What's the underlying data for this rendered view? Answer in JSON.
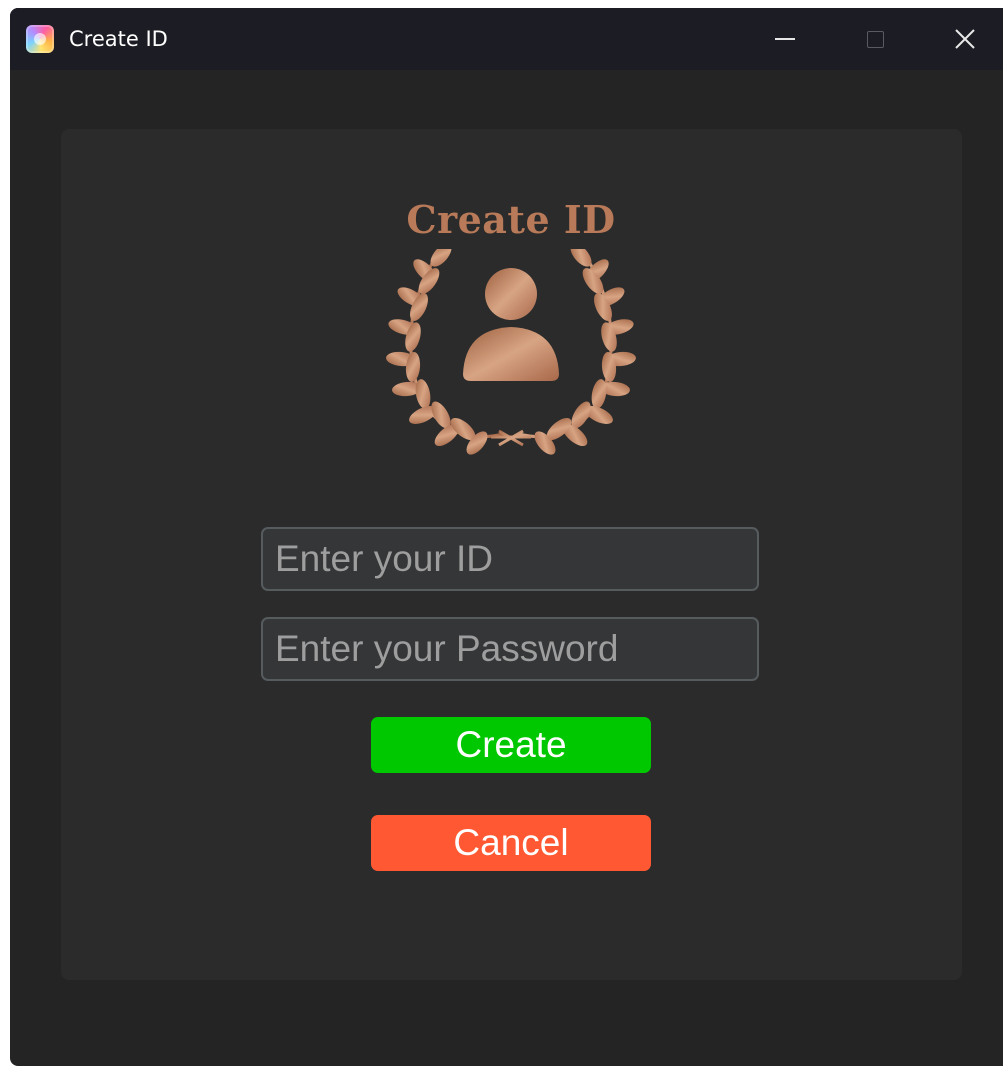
{
  "window": {
    "title": "Create ID",
    "controls": {
      "minimize": "minimize-icon",
      "maximize": "maximize-icon",
      "close": "close-icon"
    }
  },
  "logo": {
    "text": "Create ID",
    "emblem": "user-laurel-emblem",
    "color": "#b87a58"
  },
  "form": {
    "id_field": {
      "placeholder": "Enter your ID",
      "value": ""
    },
    "password_field": {
      "placeholder": "Enter your Password",
      "value": ""
    },
    "create_button": {
      "label": "Create",
      "color": "#00c800"
    },
    "cancel_button": {
      "label": "Cancel",
      "color": "#ff5833"
    }
  },
  "colors": {
    "window_background": "#242424",
    "panel_background": "#2b2b2b",
    "titlebar_background": "#1c1c24",
    "field_background": "#343638",
    "field_border": "#565b5e"
  }
}
